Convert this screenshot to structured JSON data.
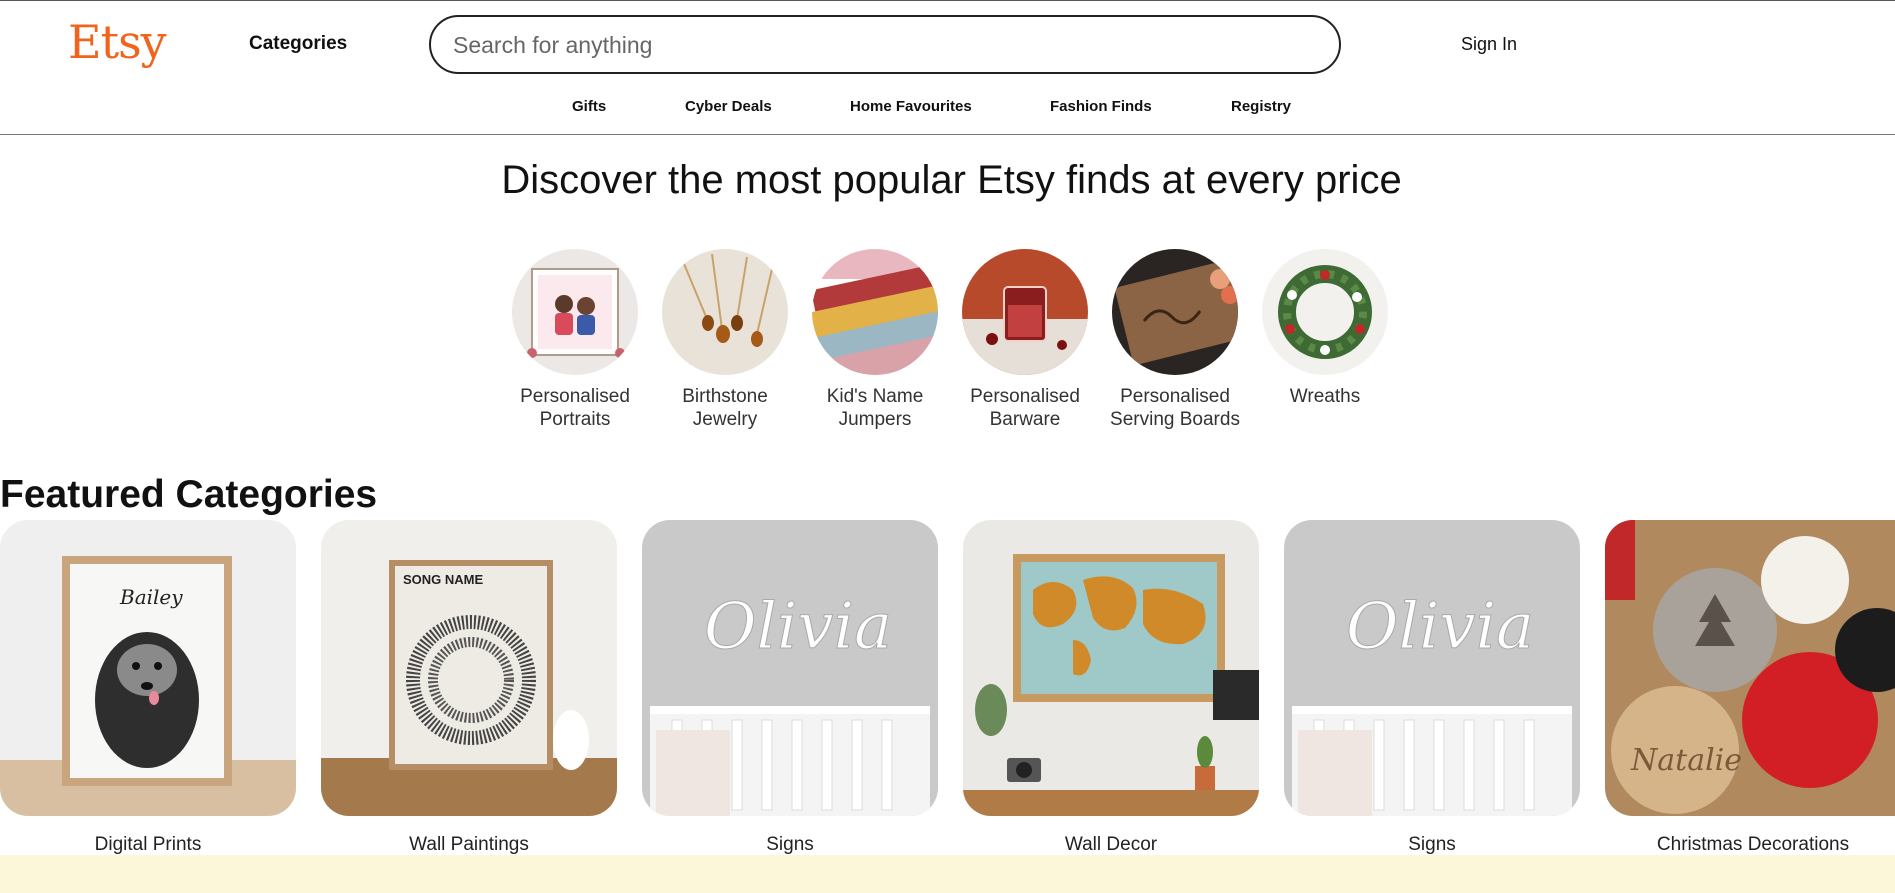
{
  "header": {
    "logo": "Etsy",
    "categories_label": "Categories",
    "search_placeholder": "Search for anything",
    "signin_label": "Sign In",
    "nav": [
      "Gifts",
      "Cyber Deals",
      "Home Favourites",
      "Fashion Finds",
      "Registry"
    ]
  },
  "hero": {
    "title": "Discover the most popular Etsy finds at every price",
    "circles": [
      {
        "label": "Personalised Portraits",
        "icon": "portrait-thumbnail"
      },
      {
        "label": "Birthstone Jewelry",
        "icon": "necklace-thumbnail"
      },
      {
        "label": "Kid's Name Jumpers",
        "icon": "jumper-thumbnail"
      },
      {
        "label": "Personalised Barware",
        "icon": "glass-thumbnail"
      },
      {
        "label": "Personalised Serving Boards",
        "icon": "board-thumbnail"
      },
      {
        "label": "Wreaths",
        "icon": "wreath-thumbnail"
      }
    ]
  },
  "featured": {
    "title": "Featured Categories",
    "cards": [
      {
        "label": "Digital Prints",
        "art_text": "Bailey"
      },
      {
        "label": "Wall Paintings",
        "art_text": "SONG NAME"
      },
      {
        "label": "Signs",
        "art_text": "Olivia"
      },
      {
        "label": "Wall Decor",
        "art_text": ""
      },
      {
        "label": "Signs",
        "art_text": "Olivia"
      },
      {
        "label": "Christmas Decorations",
        "art_text": "Natalie"
      }
    ]
  },
  "colors": {
    "brand": "#F1641E",
    "band": "#FDF7DA"
  }
}
